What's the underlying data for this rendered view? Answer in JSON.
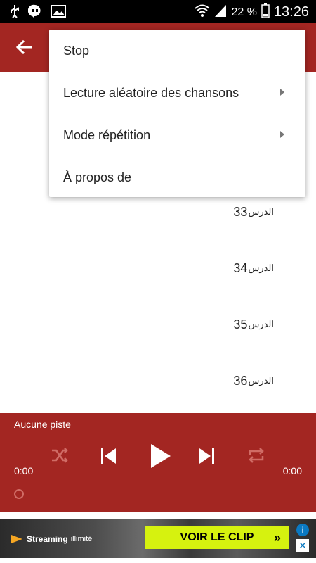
{
  "status_bar": {
    "battery_percent": "22 %",
    "time": "13:26"
  },
  "menu": {
    "items": [
      {
        "label": "Stop",
        "has_submenu": false
      },
      {
        "label": "Lecture aléatoire des chansons",
        "has_submenu": true
      },
      {
        "label": "Mode répétition",
        "has_submenu": true
      },
      {
        "label": "À propos de",
        "has_submenu": false
      }
    ]
  },
  "list": {
    "items": [
      {
        "number": "33",
        "word": "الدرس"
      },
      {
        "number": "34",
        "word": "الدرس"
      },
      {
        "number": "35",
        "word": "الدرس"
      },
      {
        "number": "36",
        "word": "الدرس"
      }
    ]
  },
  "player": {
    "track_label": "Aucune piste",
    "elapsed": "0:00",
    "duration": "0:00",
    "progress": 0
  },
  "ad": {
    "brand_bold": "Streaming",
    "brand_light": "illimité",
    "cta_label": "VOIR LE CLIP",
    "cta_chevron": "»"
  },
  "colors": {
    "primary": "#a32622",
    "ad_cta": "#d6f20f"
  }
}
